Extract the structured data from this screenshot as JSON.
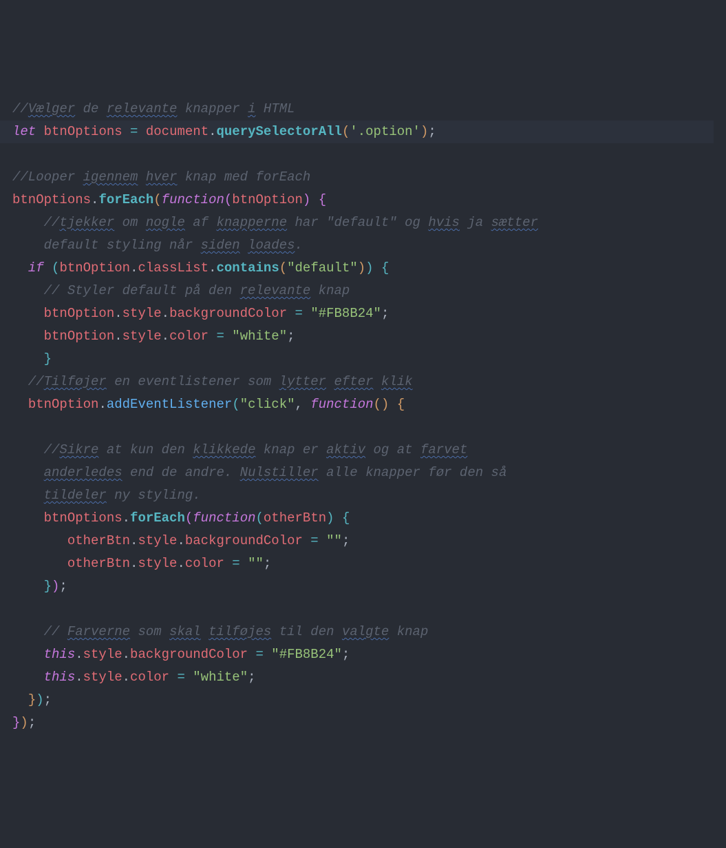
{
  "code": {
    "c1a": "//",
    "c1b": "Vælger",
    "c1c": " de ",
    "c1d": "relevante",
    "c1e": " knapper ",
    "c1f": "i",
    "c1g": " HTML",
    "kw_let": "let",
    "var_btnOptions": "btnOptions",
    "eq": " = ",
    "document": "document",
    "dot": ".",
    "querySelectorAll": "querySelectorAll",
    "lp": "(",
    "rp": ")",
    "str_option": "'.option'",
    "semi": ";",
    "c3a": "//Looper ",
    "c3b": "igennem",
    "c3c": " ",
    "c3d": "hver",
    "c3e": " knap med forEach",
    "forEach": "forEach",
    "kw_function": "function",
    "var_btnOption": "btnOption",
    "lb": "{",
    "rb": "}",
    "c5a": "    //",
    "c5b": "tjekker",
    "c5c": " om ",
    "c5d": "nogle",
    "c5e": " af ",
    "c5f": "knapperne",
    "c5g": " har \"default\" og ",
    "c5h": "hvis",
    "c5i": " ja ",
    "c5j": "sætter",
    "c6a": "    default styling når ",
    "c6b": "siden",
    "c6c": " ",
    "c6d": "loades",
    "c6e": ".",
    "kw_if": "if",
    "classList": "classList",
    "contains": "contains",
    "str_default": "\"default\"",
    "c8a": "    // Styler default på den ",
    "c8b": "relevante",
    "c8c": " knap",
    "style": "style",
    "backgroundColor": "backgroundColor",
    "color_prop": "color",
    "str_orange": "\"#FB8B24\"",
    "str_white": "\"white\"",
    "str_empty": "\"\"",
    "c10a": "  //",
    "c10b": "Tilføjer",
    "c10c": " en eventlistener som ",
    "c10d": "lytter",
    "c10e": " ",
    "c10f": "efter",
    "c10g": " ",
    "c10h": "klik",
    "addEventListener": "addEventListener",
    "str_click": "\"click\"",
    "comma": ", ",
    "c12a": "    //",
    "c12b": "Sikre",
    "c12c": " at kun den ",
    "c12d": "klikkede",
    "c12e": " knap er ",
    "c12f": "aktiv",
    "c12g": " og at ",
    "c12h": "farvet",
    "c13a": "    ",
    "c13b": "anderledes",
    "c13c": " end de andre. ",
    "c13d": "Nulstiller",
    "c13e": " alle knapper før den så",
    "c14a": "    ",
    "c14b": "tildeler",
    "c14c": " ny styling.",
    "var_otherBtn": "otherBtn",
    "c17a": "    // ",
    "c17b": "Farverne",
    "c17c": " som ",
    "c17d": "skal",
    "c17e": " ",
    "c17f": "tilføjes",
    "c17g": " til den ",
    "c17h": "valgte",
    "c17i": " knap",
    "kw_this": "this"
  }
}
